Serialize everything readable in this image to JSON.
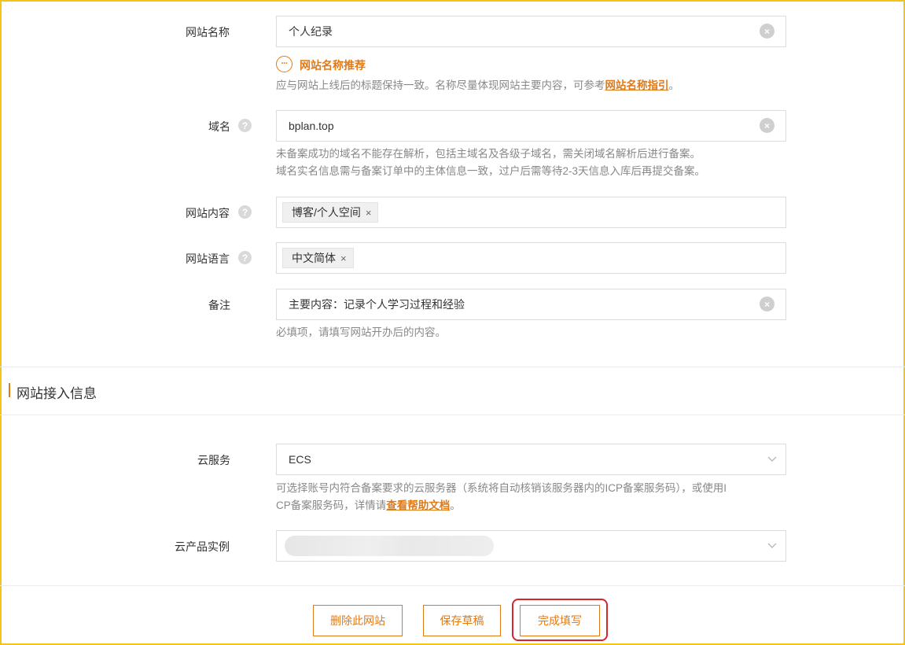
{
  "site_info": {
    "name": {
      "label": "网站名称",
      "value": "个人纪录",
      "suggest_link": "网站名称推荐",
      "hint_before": "应与网站上线后的标题保持一致。名称尽量体现网站主要内容，可参考",
      "hint_link": "网站名称指引",
      "hint_after": "。"
    },
    "domain": {
      "label": "域名",
      "value": "bplan.top",
      "hint_line1": "未备案成功的域名不能存在解析，包括主域名及各级子域名，需关闭域名解析后进行备案。",
      "hint_line2": "域名实名信息需与备案订单中的主体信息一致，过户后需等待2-3天信息入库后再提交备案。"
    },
    "content": {
      "label": "网站内容",
      "tags": [
        "博客/个人空间"
      ]
    },
    "language": {
      "label": "网站语言",
      "tags": [
        "中文简体"
      ]
    },
    "remark": {
      "label": "备注",
      "value": "主要内容：记录个人学习过程和经验",
      "hint": "必填项，请填写网站开办后的内容。"
    }
  },
  "access_section": {
    "title": "网站接入信息",
    "cloud_service": {
      "label": "云服务",
      "value": "ECS",
      "hint_line1": "可选择账号内符合备案要求的云服务器（系统将自动核销该服务器内的ICP备案服务码），或使用I",
      "hint_line2_before": "CP备案服务码，详情请",
      "hint_link": "查看帮助文档",
      "hint_line2_after": "。"
    },
    "instance": {
      "label": "云产品实例",
      "value_redacted": true
    }
  },
  "buttons": {
    "delete": "删除此网站",
    "save_draft": "保存草稿",
    "complete": "完成填写"
  },
  "icons": {
    "help": "?",
    "clear": "×",
    "tag_remove": "×",
    "suggest": "···"
  },
  "colors": {
    "accent": "#e07a17",
    "highlight_box": "#d9232e",
    "frame": "#f0c419"
  }
}
